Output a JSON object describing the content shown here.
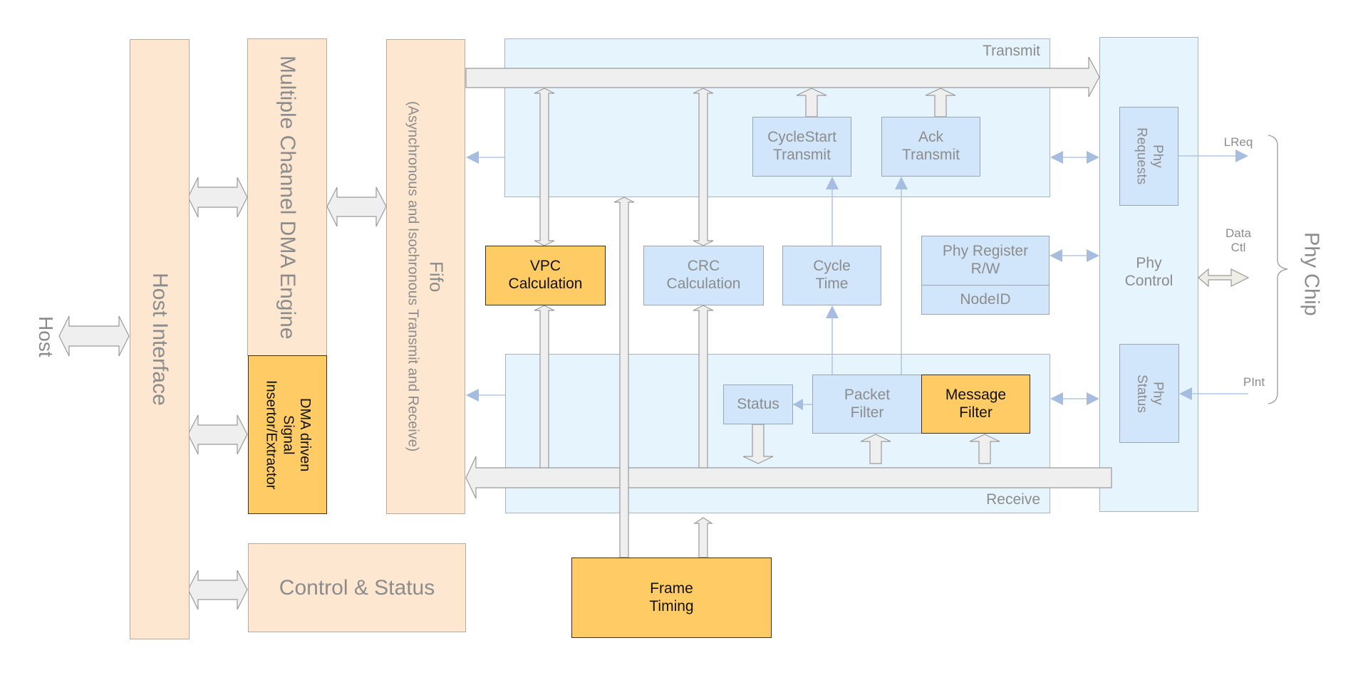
{
  "diagram": {
    "host": {
      "label": "Host"
    },
    "host_interface": {
      "label": "Host Interface"
    },
    "dma_engine": {
      "label": "Multiple Channel DMA Engine"
    },
    "dma_signal": {
      "label": "DMA driven\nSignal\nInsertor/Extractor"
    },
    "fifo": {
      "title": "Fifo",
      "subtitle": "(Asynchronous and Isochronous Transmit and Receive)"
    },
    "control_status": {
      "label": "Control & Status"
    },
    "transmit": {
      "label": "Transmit"
    },
    "receive": {
      "label": "Receive"
    },
    "cyclestart_transmit": {
      "label": "CycleStart\nTransmit"
    },
    "ack_transmit": {
      "label": "Ack\nTransmit"
    },
    "vpc_calculation": {
      "label": "VPC\nCalculation"
    },
    "crc_calculation": {
      "label": "CRC\nCalculation"
    },
    "cycle_time": {
      "label": "Cycle\nTime"
    },
    "phy_register": {
      "label": "Phy Register\nR/W",
      "sub_label": "NodeID"
    },
    "status": {
      "label": "Status"
    },
    "packet_filter": {
      "label": "Packet\nFilter"
    },
    "message_filter": {
      "label": "Message\nFilter"
    },
    "frame_timing": {
      "label": "Frame\nTiming"
    },
    "phy_control": {
      "label": "Phy\nControl"
    },
    "phy_requests": {
      "label": "Phy\nRequests"
    },
    "phy_status": {
      "label": "Phy\nStatus"
    },
    "signals": {
      "lreq": "LReq",
      "data_ctl": "Data\nCtl",
      "pint": "PInt"
    },
    "phy_chip": {
      "label": "Phy Chip"
    }
  },
  "colors": {
    "peach": "#fde7d0",
    "light_blue": "#e6f4fd",
    "mid_blue": "#d1e6fb",
    "highlight_orange": "#fecb64",
    "bus_gray": "#efefef",
    "signal_blue": "#a6bde0",
    "text_gray": "#8c8c8c"
  }
}
